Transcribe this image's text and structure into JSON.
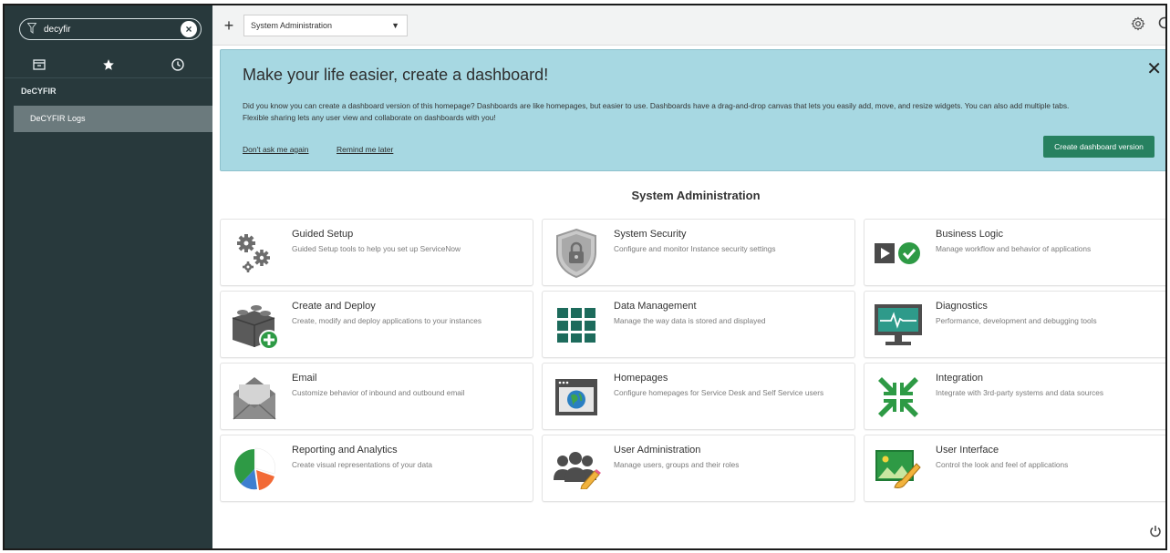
{
  "sidebar": {
    "filter_value": "decyfir",
    "clear_label": "×",
    "application": "DeCYFIR",
    "modules": [
      {
        "label": "DeCYFIR Logs"
      }
    ]
  },
  "topbar": {
    "add_label": "+",
    "dashboard_select": "System Administration",
    "caret": "▼"
  },
  "banner": {
    "title": "Make your life easier, create a dashboard!",
    "text_line1": "Did you know you can create a dashboard version of this homepage? Dashboards are like homepages, but easier to use. Dashboards have a drag-and-drop canvas that lets you easily add, move, and resize widgets. You can also add multiple tabs.",
    "text_line2": "Flexible sharing lets any user view and collaborate on dashboards with you!",
    "dont_ask": "Don't ask me again",
    "remind_later": "Remind me later",
    "create_button": "Create dashboard version",
    "close": "✕"
  },
  "section_title": "System Administration",
  "tiles": [
    {
      "title": "Guided Setup",
      "desc": "Guided Setup tools to help you set up ServiceNow",
      "icon": "gears-icon"
    },
    {
      "title": "System Security",
      "desc": "Configure and monitor Instance security settings",
      "icon": "shield-lock-icon"
    },
    {
      "title": "Business Logic",
      "desc": "Manage workflow and behavior of applications",
      "icon": "play-check-icon"
    },
    {
      "title": "Create and Deploy",
      "desc": "Create, modify and deploy applications to your instances",
      "icon": "blocks-plus-icon"
    },
    {
      "title": "Data Management",
      "desc": "Manage the way data is stored and displayed",
      "icon": "grid-icon"
    },
    {
      "title": "Diagnostics",
      "desc": "Performance, development and debugging tools",
      "icon": "monitor-pulse-icon"
    },
    {
      "title": "Email",
      "desc": "Customize behavior of inbound and outbound email",
      "icon": "envelope-icon"
    },
    {
      "title": "Homepages",
      "desc": "Configure homepages for Service Desk and Self Service users",
      "icon": "browser-globe-icon"
    },
    {
      "title": "Integration",
      "desc": "Integrate with 3rd-party systems and data sources",
      "icon": "arrows-in-icon"
    },
    {
      "title": "Reporting and Analytics",
      "desc": "Create visual representations of your data",
      "icon": "pie-chart-icon"
    },
    {
      "title": "User Administration",
      "desc": "Manage users, groups and their roles",
      "icon": "users-pencil-icon"
    },
    {
      "title": "User Interface",
      "desc": "Control the look and feel of applications",
      "icon": "picture-brush-icon"
    }
  ],
  "colors": {
    "sidebar_bg": "#28393c",
    "banner_bg": "#a7d8e2",
    "primary_button": "#278160",
    "icon_gray": "#6d6d6d",
    "icon_teal": "#1d6b5c",
    "icon_green": "#2e9a45"
  }
}
